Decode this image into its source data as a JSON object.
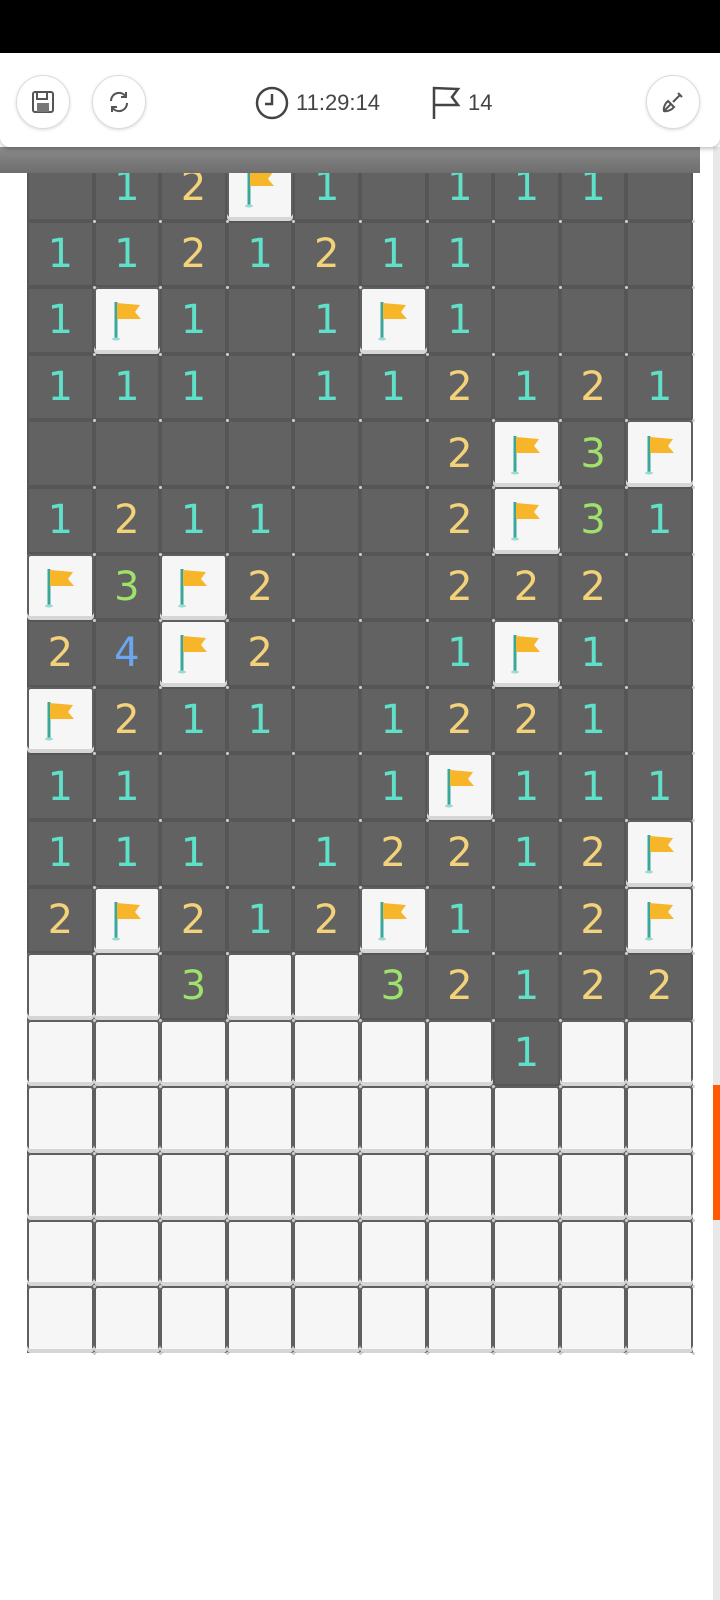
{
  "toolbar": {
    "time": "11:29:14",
    "flags_remaining": "14",
    "save_icon": "save-icon",
    "restart_icon": "restart-icon",
    "clock_icon": "clock-icon",
    "flag_icon": "flag-icon",
    "shovel_icon": "shovel-icon"
  },
  "board": {
    "columns": 10,
    "rows": [
      [
        "o",
        "1",
        "2",
        "F",
        "1",
        "o",
        "1",
        "1",
        "1",
        "o"
      ],
      [
        "1",
        "1",
        "2",
        "1",
        "2",
        "1",
        "1",
        "o",
        "o",
        "o"
      ],
      [
        "1",
        "F",
        "1",
        "o",
        "1",
        "F",
        "1",
        "o",
        "o",
        "o"
      ],
      [
        "1",
        "1",
        "1",
        "o",
        "1",
        "1",
        "2",
        "1",
        "2",
        "1"
      ],
      [
        "o",
        "o",
        "o",
        "o",
        "o",
        "o",
        "2",
        "F",
        "3",
        "F"
      ],
      [
        "1",
        "2",
        "1",
        "1",
        "o",
        "o",
        "2",
        "F",
        "3",
        "1"
      ],
      [
        "F",
        "3",
        "F",
        "2",
        "o",
        "o",
        "2",
        "2",
        "2",
        "o"
      ],
      [
        "2",
        "4",
        "F",
        "2",
        "o",
        "o",
        "1",
        "F",
        "1",
        "o"
      ],
      [
        "F",
        "2",
        "1",
        "1",
        "o",
        "1",
        "2",
        "2",
        "1",
        "o"
      ],
      [
        "1",
        "1",
        "o",
        "o",
        "o",
        "1",
        "F",
        "1",
        "1",
        "1"
      ],
      [
        "1",
        "1",
        "1",
        "o",
        "1",
        "2",
        "2",
        "1",
        "2",
        "F"
      ],
      [
        "2",
        "F",
        "2",
        "1",
        "2",
        "F",
        "1",
        "o",
        "2",
        "F"
      ],
      [
        "C",
        "C",
        "3",
        "C",
        "C",
        "3",
        "2",
        "1",
        "2",
        "2"
      ],
      [
        "C",
        "C",
        "C",
        "C",
        "C",
        "C",
        "C",
        "1",
        "C",
        "C"
      ],
      [
        "C",
        "C",
        "C",
        "C",
        "C",
        "C",
        "C",
        "C",
        "C",
        "C"
      ],
      [
        "C",
        "C",
        "C",
        "C",
        "C",
        "C",
        "C",
        "C",
        "C",
        "C"
      ],
      [
        "C",
        "C",
        "C",
        "C",
        "C",
        "C",
        "C",
        "C",
        "C",
        "C"
      ],
      [
        "C",
        "C",
        "C",
        "C",
        "C",
        "C",
        "C",
        "C",
        "C",
        "C"
      ]
    ]
  },
  "colors": {
    "num1": "#5fe0c8",
    "num2": "#f4d27a",
    "num3": "#9fe26b",
    "num4": "#6ba6f0",
    "flag": "#f7b52a",
    "scroll_thumb": "#ff5a00"
  }
}
